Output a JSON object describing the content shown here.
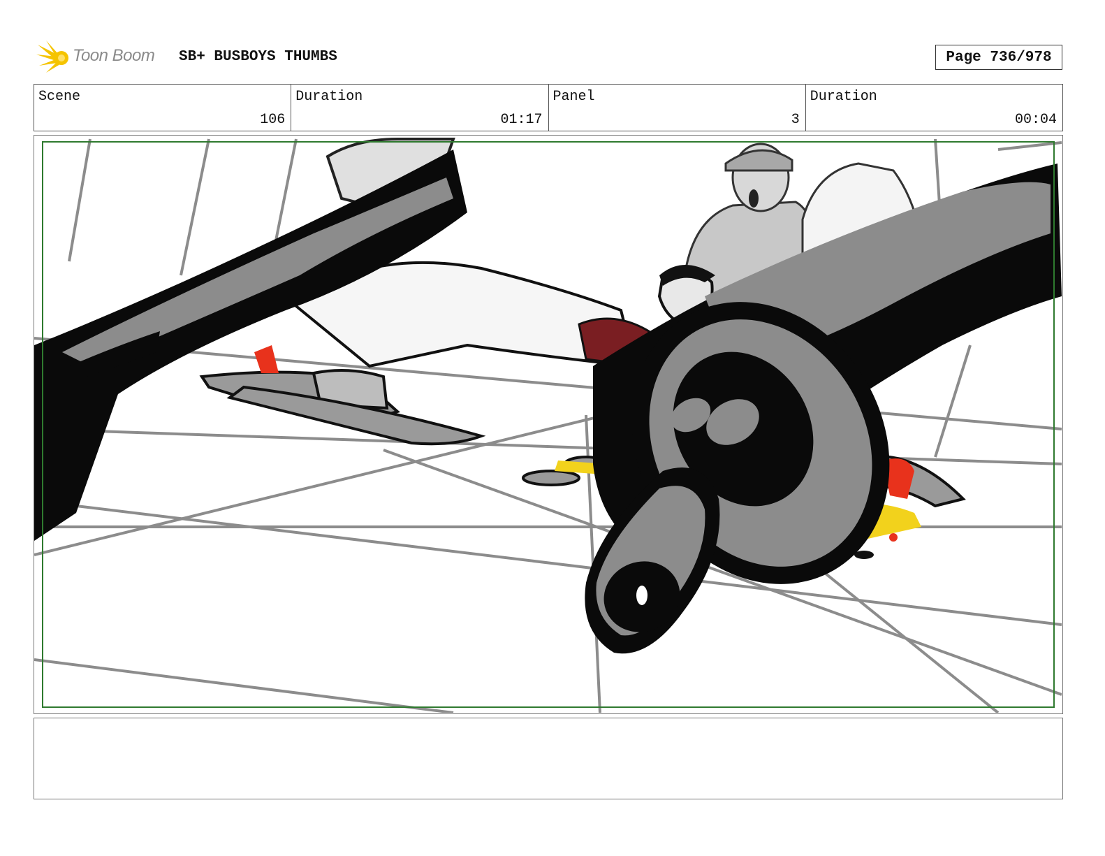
{
  "header": {
    "logo_text": "Toon Boom",
    "project_title": "SB+ BUSBOYS THUMBS",
    "page_label": "Page 736/978"
  },
  "info": {
    "scene_label": "Scene",
    "scene_value": "106",
    "scene_duration_label": "Duration",
    "scene_duration_value": "01:17",
    "panel_label": "Panel",
    "panel_value": "3",
    "panel_duration_label": "Duration",
    "panel_duration_value": "00:04"
  },
  "colors": {
    "safe_area_border": "#2f7a2f",
    "accent_red": "#e8321c",
    "accent_yellow": "#f2d21c",
    "sketch_gray": "#8c8c8c",
    "sketch_black": "#0a0a0a"
  },
  "notes": {
    "text": ""
  }
}
